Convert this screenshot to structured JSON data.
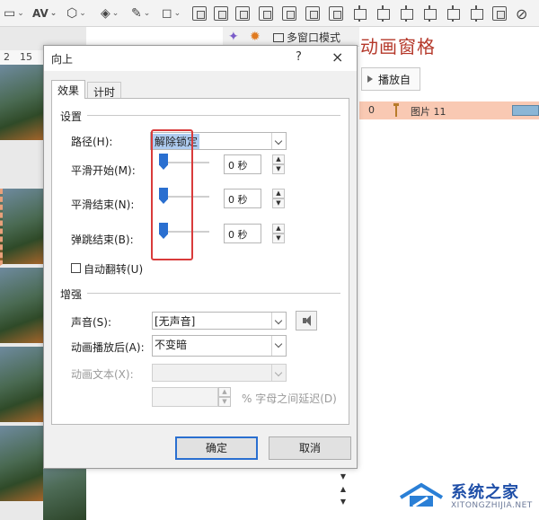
{
  "ribbon": {
    "tool_icons": [
      "shape-fill-icon",
      "char-spacing-icon",
      "shapes-icon",
      "fill-color-icon",
      "pen-outline-icon",
      "arrange-icons",
      "align-icons"
    ],
    "char_spacing_label": "AV"
  },
  "toolbar2": {
    "multi_window_label": "多窗口模式"
  },
  "ruler": {
    "mark_left": "2",
    "mark_right": "15"
  },
  "animation_pane": {
    "title": "动画窗格",
    "play_button": "播放自",
    "row": {
      "order": "0",
      "name": "图片 11"
    }
  },
  "dialog": {
    "title": "向上",
    "help": "?",
    "close": "×",
    "tabs": [
      {
        "label": "效果"
      },
      {
        "label": "计时"
      }
    ],
    "settings": {
      "heading": "设置",
      "path_label": "路径(H):",
      "path_value": "解除锁定",
      "smooth_start_label": "平滑开始(M):",
      "smooth_start_value": "0 秒",
      "smooth_end_label": "平滑结束(N):",
      "smooth_end_value": "0 秒",
      "bounce_end_label": "弹跳结束(B):",
      "bounce_end_value": "0 秒",
      "auto_reverse_label": "自动翻转(U)"
    },
    "enhance": {
      "heading": "增强",
      "sound_label": "声音(S):",
      "sound_value": "[无声音]",
      "after_label": "动画播放后(A):",
      "after_value": "不变暗",
      "text_label": "动画文本(X):",
      "text_value": "",
      "delay_suffix": "% 字母之间延迟(D)"
    },
    "ok": "确定",
    "cancel": "取消"
  },
  "watermark": {
    "cn": "系统之家",
    "en": "XITONGZHIJIA.NET"
  },
  "colors": {
    "accent": "#2a6fd0",
    "highlight_box": "#d93b3b",
    "pane_title": "#b5382a",
    "pane_row": "#f9c9b3"
  }
}
